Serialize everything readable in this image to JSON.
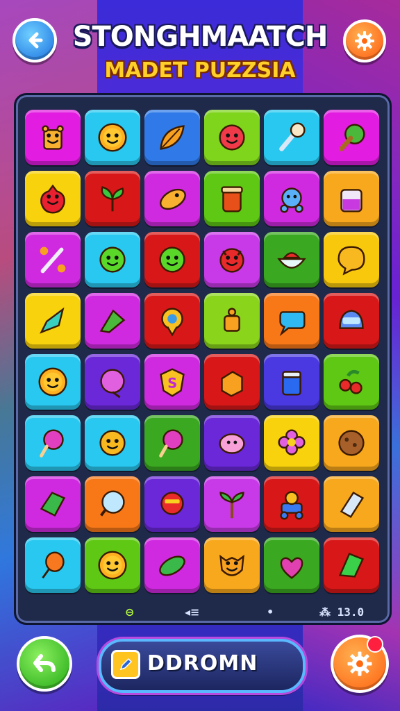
{
  "header": {
    "title": "STONGHMAATCH",
    "subtitle": "MADET PUZZSIA",
    "back_icon": "arrow-left-icon",
    "settings_icon": "gear-icon"
  },
  "board": {
    "rows": [
      [
        {
          "color": "#e21ce0",
          "icon": "cup-icon"
        },
        {
          "color": "#28c8f0",
          "icon": "sun-face-icon"
        },
        {
          "color": "#2f7ae8",
          "icon": "leaf-icon"
        },
        {
          "color": "#7fd41c",
          "icon": "red-ball-icon"
        },
        {
          "color": "#28c8f0",
          "icon": "brush-icon"
        },
        {
          "color": "#e21ce0",
          "icon": "broccoli-icon"
        }
      ],
      [
        {
          "color": "#f8d20c",
          "icon": "red-creature-icon"
        },
        {
          "color": "#d81818",
          "icon": "plant-icon"
        },
        {
          "color": "#d02ae0",
          "icon": "rocket-fish-icon"
        },
        {
          "color": "#5fc814",
          "icon": "jar-icon"
        },
        {
          "color": "#d02ae0",
          "icon": "robot-icon"
        },
        {
          "color": "#f8a81c",
          "icon": "potion-jar-icon"
        }
      ],
      [
        {
          "color": "#d02ae0",
          "icon": "pen-flower-icon"
        },
        {
          "color": "#28c8f0",
          "icon": "green-face-icon"
        },
        {
          "color": "#d81818",
          "icon": "green-face-icon"
        },
        {
          "color": "#c83ae8",
          "icon": "red-devil-icon"
        },
        {
          "color": "#3aa820",
          "icon": "bowl-icon"
        },
        {
          "color": "#f8c80c",
          "icon": "speech-bubble-icon"
        }
      ],
      [
        {
          "color": "#f8d20c",
          "icon": "crystal-icon"
        },
        {
          "color": "#d02ae0",
          "icon": "leaf-kite-icon"
        },
        {
          "color": "#d81818",
          "icon": "map-pin-icon"
        },
        {
          "color": "#8ad41c",
          "icon": "lantern-icon"
        },
        {
          "color": "#f87818",
          "icon": "chat-icon"
        },
        {
          "color": "#d81818",
          "icon": "helmet-icon"
        }
      ],
      [
        {
          "color": "#28c8f0",
          "icon": "sun-face-icon"
        },
        {
          "color": "#6a28d8",
          "icon": "ornament-icon"
        },
        {
          "color": "#d02ae0",
          "icon": "shield-icon"
        },
        {
          "color": "#d81818",
          "icon": "box-icon"
        },
        {
          "color": "#4a38e0",
          "icon": "can-icon"
        },
        {
          "color": "#5fc814",
          "icon": "berries-icon"
        }
      ],
      [
        {
          "color": "#28c8f0",
          "icon": "lollipop-icon"
        },
        {
          "color": "#28c8f0",
          "icon": "smile-face-icon"
        },
        {
          "color": "#3aa820",
          "icon": "lollipop-icon"
        },
        {
          "color": "#6a28d8",
          "icon": "pig-icon"
        },
        {
          "color": "#f8d20c",
          "icon": "flower-icon"
        },
        {
          "color": "#f8a81c",
          "icon": "cookie-icon"
        }
      ],
      [
        {
          "color": "#d02ae0",
          "icon": "gem-icon"
        },
        {
          "color": "#f87818",
          "icon": "mirror-icon"
        },
        {
          "color": "#6a28d8",
          "icon": "robot-face-icon"
        },
        {
          "color": "#c83ae8",
          "icon": "tree-icon"
        },
        {
          "color": "#d81818",
          "icon": "robot-car-icon"
        },
        {
          "color": "#f8a81c",
          "icon": "crystal-pack-icon"
        }
      ],
      [
        {
          "color": "#28c8f0",
          "icon": "balloon-icon"
        },
        {
          "color": "#5fc814",
          "icon": "sun-face-icon"
        },
        {
          "color": "#d02ae0",
          "icon": "pickle-icon"
        },
        {
          "color": "#f8a81c",
          "icon": "cat-face-icon"
        },
        {
          "color": "#3aa820",
          "icon": "heart-leaf-icon"
        },
        {
          "color": "#d81818",
          "icon": "green-gem-icon"
        }
      ]
    ]
  },
  "footer": {
    "sym1": "⊖",
    "sym2": "◂≡",
    "sym3": "•",
    "score": "⁂ 13.0"
  },
  "bottom_bar": {
    "undo_icon": "undo-arrow-icon",
    "action_label": "DDROMN",
    "action_icon": "pencil-icon",
    "settings_icon": "gear-icon"
  }
}
